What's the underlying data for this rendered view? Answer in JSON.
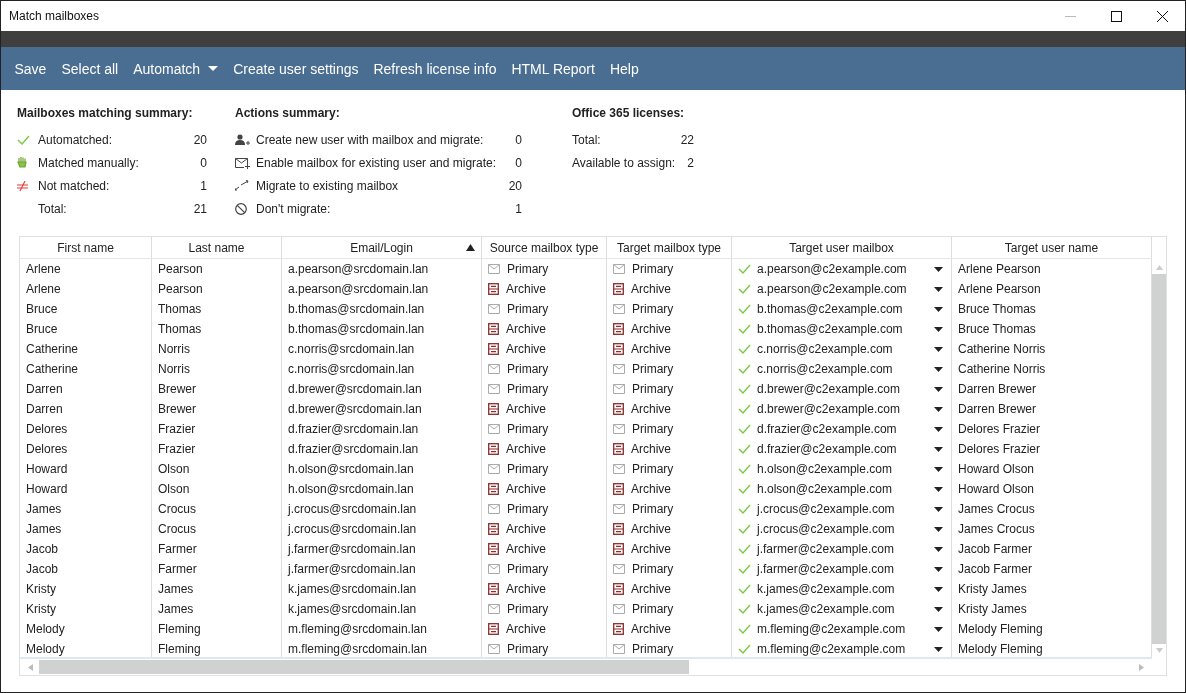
{
  "window": {
    "title": "Match mailboxes"
  },
  "toolbar": [
    {
      "label": "Save",
      "kind": "plain"
    },
    {
      "label": "Select all",
      "kind": "plain"
    },
    {
      "label": "Automatch",
      "kind": "dropdown"
    },
    {
      "label": "Create user settings",
      "kind": "plain"
    },
    {
      "label": "Refresh license info",
      "kind": "plain"
    },
    {
      "label": "HTML Report",
      "kind": "plain"
    },
    {
      "label": "Help",
      "kind": "plain"
    }
  ],
  "matching_summary": {
    "title": "Mailboxes matching summary:",
    "items": [
      {
        "kind": "auto",
        "label": "Automatched:",
        "value": "20"
      },
      {
        "kind": "manual",
        "label": "Matched manually:",
        "value": "0"
      },
      {
        "kind": "unmatched",
        "label": "Not matched:",
        "value": "1"
      },
      {
        "kind": "total",
        "label": "Total:",
        "value": "21"
      }
    ]
  },
  "actions_summary": {
    "title": "Actions summary:",
    "items": [
      {
        "kind": "new-user",
        "label": "Create new user with mailbox and migrate:",
        "value": "0"
      },
      {
        "kind": "enable",
        "label": "Enable mailbox for existing user and migrate:",
        "value": "0"
      },
      {
        "kind": "migrate",
        "label": "Migrate to existing mailbox",
        "value": "20"
      },
      {
        "kind": "skip",
        "label": "Don't migrate:",
        "value": "1"
      }
    ]
  },
  "licenses": {
    "title": "Office 365 licenses:",
    "items": [
      {
        "label": "Total:",
        "value": "22"
      },
      {
        "label": "Available to assign:",
        "value": "2"
      }
    ]
  },
  "table": {
    "columns": [
      {
        "label": "First name",
        "sorted": false
      },
      {
        "label": "Last name",
        "sorted": false
      },
      {
        "label": "Email/Login",
        "sorted": true
      },
      {
        "label": "Source mailbox type",
        "sorted": false
      },
      {
        "label": "Target mailbox type",
        "sorted": false
      },
      {
        "label": "Target user mailbox",
        "sorted": false
      },
      {
        "label": "Target user name",
        "sorted": false
      }
    ],
    "rows": [
      {
        "first": "Arlene",
        "last": "Pearson",
        "email": "a.pearson@srcdomain.lan",
        "source": {
          "kind": "primary",
          "label": "Primary"
        },
        "target": {
          "kind": "primary",
          "label": "Primary"
        },
        "matched": true,
        "mailbox": "a.pearson@c2example.com",
        "name": "Arlene Pearson"
      },
      {
        "first": "Arlene",
        "last": "Pearson",
        "email": "a.pearson@srcdomain.lan",
        "source": {
          "kind": "archive",
          "label": "Archive"
        },
        "target": {
          "kind": "archive",
          "label": "Archive"
        },
        "matched": true,
        "mailbox": "a.pearson@c2example.com",
        "name": "Arlene Pearson"
      },
      {
        "first": "Bruce",
        "last": "Thomas",
        "email": "b.thomas@srcdomain.lan",
        "source": {
          "kind": "primary",
          "label": "Primary"
        },
        "target": {
          "kind": "primary",
          "label": "Primary"
        },
        "matched": true,
        "mailbox": "b.thomas@c2example.com",
        "name": "Bruce Thomas"
      },
      {
        "first": "Bruce",
        "last": "Thomas",
        "email": "b.thomas@srcdomain.lan",
        "source": {
          "kind": "archive",
          "label": "Archive"
        },
        "target": {
          "kind": "archive",
          "label": "Archive"
        },
        "matched": true,
        "mailbox": "b.thomas@c2example.com",
        "name": "Bruce Thomas"
      },
      {
        "first": "Catherine",
        "last": "Norris",
        "email": "c.norris@srcdomain.lan",
        "source": {
          "kind": "archive",
          "label": "Archive"
        },
        "target": {
          "kind": "archive",
          "label": "Archive"
        },
        "matched": true,
        "mailbox": "c.norris@c2example.com",
        "name": "Catherine Norris"
      },
      {
        "first": "Catherine",
        "last": "Norris",
        "email": "c.norris@srcdomain.lan",
        "source": {
          "kind": "primary",
          "label": "Primary"
        },
        "target": {
          "kind": "primary",
          "label": "Primary"
        },
        "matched": true,
        "mailbox": "c.norris@c2example.com",
        "name": "Catherine Norris"
      },
      {
        "first": "Darren",
        "last": "Brewer",
        "email": "d.brewer@srcdomain.lan",
        "source": {
          "kind": "primary",
          "label": "Primary"
        },
        "target": {
          "kind": "primary",
          "label": "Primary"
        },
        "matched": true,
        "mailbox": "d.brewer@c2example.com",
        "name": "Darren Brewer"
      },
      {
        "first": "Darren",
        "last": "Brewer",
        "email": "d.brewer@srcdomain.lan",
        "source": {
          "kind": "archive",
          "label": "Archive"
        },
        "target": {
          "kind": "archive",
          "label": "Archive"
        },
        "matched": true,
        "mailbox": "d.brewer@c2example.com",
        "name": "Darren Brewer"
      },
      {
        "first": "Delores",
        "last": "Frazier",
        "email": "d.frazier@srcdomain.lan",
        "source": {
          "kind": "primary",
          "label": "Primary"
        },
        "target": {
          "kind": "primary",
          "label": "Primary"
        },
        "matched": true,
        "mailbox": "d.frazier@c2example.com",
        "name": "Delores Frazier"
      },
      {
        "first": "Delores",
        "last": "Frazier",
        "email": "d.frazier@srcdomain.lan",
        "source": {
          "kind": "archive",
          "label": "Archive"
        },
        "target": {
          "kind": "archive",
          "label": "Archive"
        },
        "matched": true,
        "mailbox": "d.frazier@c2example.com",
        "name": "Delores Frazier"
      },
      {
        "first": "Howard",
        "last": "Olson",
        "email": "h.olson@srcdomain.lan",
        "source": {
          "kind": "primary",
          "label": "Primary"
        },
        "target": {
          "kind": "primary",
          "label": "Primary"
        },
        "matched": true,
        "mailbox": "h.olson@c2example.com",
        "name": "Howard Olson"
      },
      {
        "first": "Howard",
        "last": "Olson",
        "email": "h.olson@srcdomain.lan",
        "source": {
          "kind": "archive",
          "label": "Archive"
        },
        "target": {
          "kind": "archive",
          "label": "Archive"
        },
        "matched": true,
        "mailbox": "h.olson@c2example.com",
        "name": "Howard Olson"
      },
      {
        "first": "James",
        "last": "Crocus",
        "email": "j.crocus@srcdomain.lan",
        "source": {
          "kind": "primary",
          "label": "Primary"
        },
        "target": {
          "kind": "primary",
          "label": "Primary"
        },
        "matched": true,
        "mailbox": "j.crocus@c2example.com",
        "name": "James Crocus"
      },
      {
        "first": "James",
        "last": "Crocus",
        "email": "j.crocus@srcdomain.lan",
        "source": {
          "kind": "archive",
          "label": "Archive"
        },
        "target": {
          "kind": "archive",
          "label": "Archive"
        },
        "matched": true,
        "mailbox": "j.crocus@c2example.com",
        "name": "James Crocus"
      },
      {
        "first": "Jacob",
        "last": "Farmer",
        "email": "j.farmer@srcdomain.lan",
        "source": {
          "kind": "archive",
          "label": "Archive"
        },
        "target": {
          "kind": "archive",
          "label": "Archive"
        },
        "matched": true,
        "mailbox": "j.farmer@c2example.com",
        "name": "Jacob Farmer"
      },
      {
        "first": "Jacob",
        "last": "Farmer",
        "email": "j.farmer@srcdomain.lan",
        "source": {
          "kind": "primary",
          "label": "Primary"
        },
        "target": {
          "kind": "primary",
          "label": "Primary"
        },
        "matched": true,
        "mailbox": "j.farmer@c2example.com",
        "name": "Jacob Farmer"
      },
      {
        "first": "Kristy",
        "last": "James",
        "email": "k.james@srcdomain.lan",
        "source": {
          "kind": "archive",
          "label": "Archive"
        },
        "target": {
          "kind": "archive",
          "label": "Archive"
        },
        "matched": true,
        "mailbox": "k.james@c2example.com",
        "name": "Kristy James"
      },
      {
        "first": "Kristy",
        "last": "James",
        "email": "k.james@srcdomain.lan",
        "source": {
          "kind": "primary",
          "label": "Primary"
        },
        "target": {
          "kind": "primary",
          "label": "Primary"
        },
        "matched": true,
        "mailbox": "k.james@c2example.com",
        "name": "Kristy James"
      },
      {
        "first": "Melody",
        "last": "Fleming",
        "email": "m.fleming@srcdomain.lan",
        "source": {
          "kind": "archive",
          "label": "Archive"
        },
        "target": {
          "kind": "archive",
          "label": "Archive"
        },
        "matched": true,
        "mailbox": "m.fleming@c2example.com",
        "name": "Melody Fleming"
      },
      {
        "first": "Melody",
        "last": "Fleming",
        "email": "m.fleming@srcdomain.lan",
        "source": {
          "kind": "primary",
          "label": "Primary"
        },
        "target": {
          "kind": "primary",
          "label": "Primary"
        },
        "matched": true,
        "mailbox": "m.fleming@c2example.com",
        "name": "Melody Fleming"
      }
    ]
  }
}
